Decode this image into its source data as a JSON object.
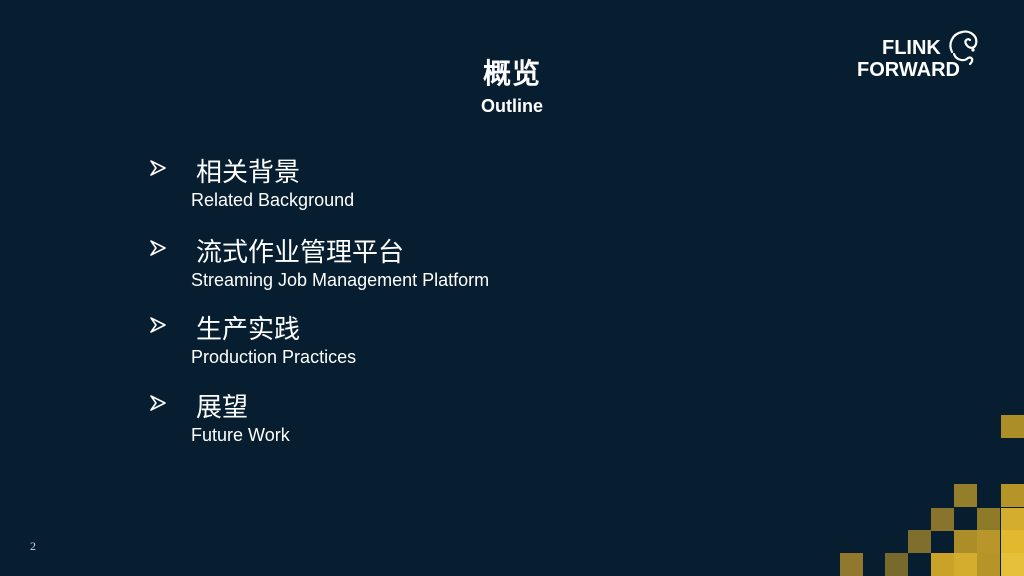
{
  "slide": {
    "title_cn": "概览",
    "title_en": "Outline",
    "logo": {
      "line1": "FLINK",
      "line2": "FORWARD"
    },
    "items": [
      {
        "cn": "相关背景",
        "en": "Related Background"
      },
      {
        "cn": "流式作业管理平台",
        "en": "Streaming Job Management Platform"
      },
      {
        "cn": "生产实践",
        "en": "Production Practices"
      },
      {
        "cn": "展望",
        "en": "Future Work"
      }
    ],
    "page_number": "2",
    "icons": {
      "bullet": "arrow-bullet-icon",
      "logo": "squirrel-logo-icon"
    },
    "colors": {
      "background": "#061e30",
      "accent_gold": "#c9a227",
      "text": "#ffffff"
    }
  }
}
